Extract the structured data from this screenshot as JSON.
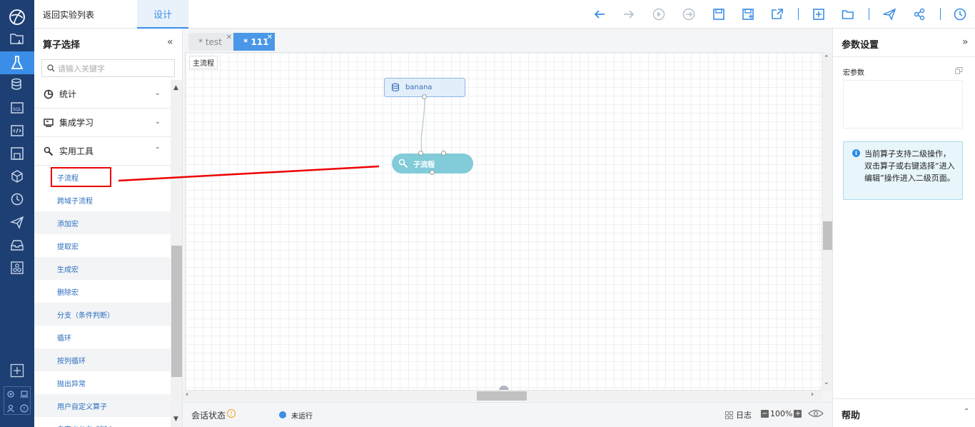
{
  "header": {
    "back_link": "返回实验列表",
    "design_tab": "设计"
  },
  "toolbar": {
    "icons": [
      "undo-icon",
      "redo-icon",
      "run-icon",
      "run-from-here-icon",
      "save-icon",
      "save-as-icon",
      "export-icon",
      "new-icon",
      "open-icon",
      "publish-icon",
      "share-icon",
      "history-icon"
    ]
  },
  "operator_panel": {
    "title": "算子选择",
    "search_placeholder": "请输入关键字",
    "categories": [
      {
        "label": "统计",
        "expanded": false
      },
      {
        "label": "集成学习",
        "expanded": false
      },
      {
        "label": "实用工具",
        "expanded": true
      }
    ],
    "items": [
      "子流程",
      "跨域子流程",
      "添加宏",
      "提取宏",
      "生成宏",
      "删除宏",
      "分支（条件判断）",
      "循环",
      "按列循环",
      "抛出异常",
      "用户自定义算子",
      "自定义分布式脚本"
    ],
    "highlighted_item": "子流程"
  },
  "canvas": {
    "tabs": [
      {
        "label": "* test",
        "close": "✕",
        "active": false
      },
      {
        "label": "* 111",
        "close": "✕",
        "active": true
      }
    ],
    "flow_label": "主流程",
    "nodes": {
      "banana": "banana",
      "subflow": "子流程"
    }
  },
  "status_bar": {
    "session_label": "会话状态",
    "warn": "!",
    "state": "未运行",
    "log": "日志",
    "zoom": "100%",
    "zoom_in": "+",
    "zoom_out": "−"
  },
  "params_panel": {
    "title": "参数设置",
    "macro_label": "宏参数",
    "info_icon": "i",
    "info_text": "当前算子支持二级操作，双击算子或右键选择“进入编辑”操作进入二级页面。",
    "help_title": "帮助"
  },
  "colors": {
    "rail_bg": "#1e3f73",
    "accent": "#3a8ee6",
    "subflow_node": "#82cbd8",
    "annotation": "#ee0000"
  }
}
